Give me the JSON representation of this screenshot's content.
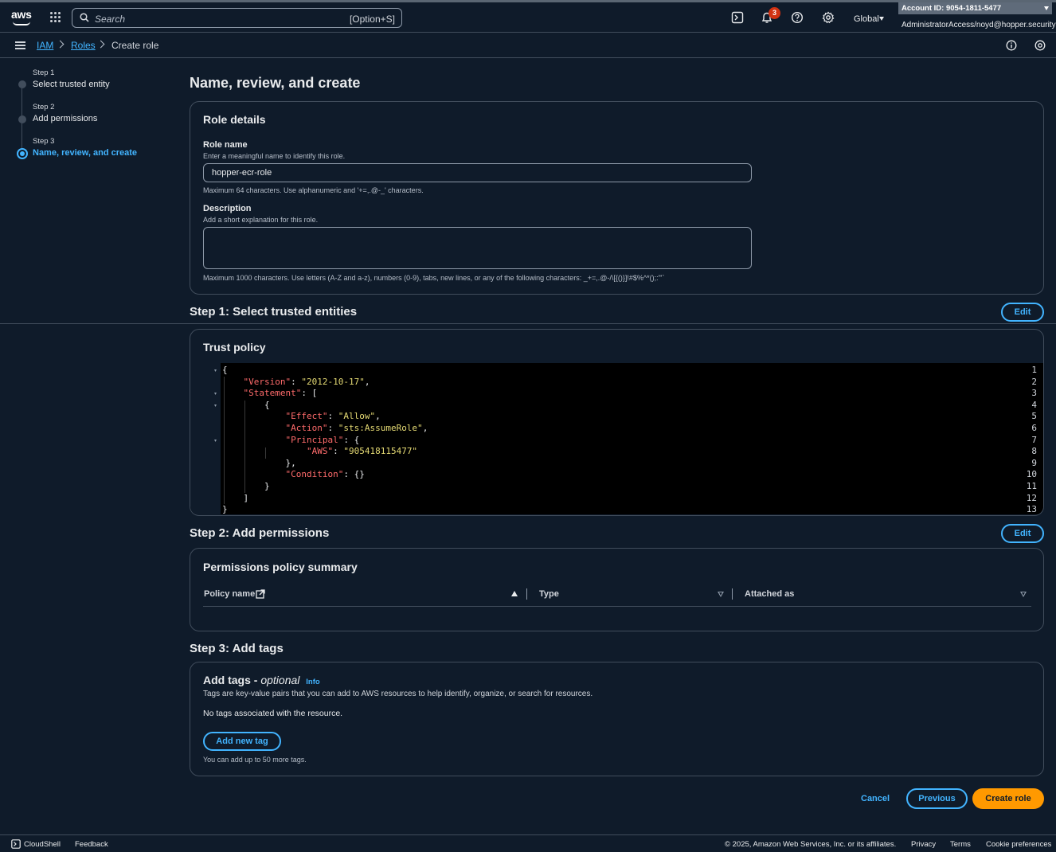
{
  "topnav": {
    "logo_text": "aws",
    "search_placeholder": "Search",
    "search_shortcut": "[Option+S]",
    "notification_count": "3",
    "region": "Global",
    "account_id": "Account ID: 9054-1811-5477",
    "account_user": "AdministratorAccess/noyd@hopper.security"
  },
  "breadcrumb": {
    "items": [
      "IAM",
      "Roles",
      "Create role"
    ]
  },
  "steps": [
    {
      "label": "Step 1",
      "title": "Select trusted entity"
    },
    {
      "label": "Step 2",
      "title": "Add permissions"
    },
    {
      "label": "Step 3",
      "title": "Name, review, and create"
    }
  ],
  "page_title": "Name, review, and create",
  "role_details": {
    "title": "Role details",
    "role_name_label": "Role name",
    "role_name_hint": "Enter a meaningful name to identify this role.",
    "role_name_value": "hopper-ecr-role",
    "role_name_constraint": "Maximum 64 characters. Use alphanumeric and '+=,.@-_' characters.",
    "description_label": "Description",
    "description_hint": "Add a short explanation for this role.",
    "description_value": "",
    "description_constraint": "Maximum 1000 characters. Use letters (A-Z and a-z), numbers (0-9), tabs, new lines, or any of the following characters: _+=,.@-/\\[{()}]!#$%^*();:\"'`"
  },
  "step1": {
    "heading": "Step 1: Select trusted entities",
    "edit_label": "Edit",
    "card_title": "Trust policy",
    "code_lines": [
      {
        "n": "1",
        "html": "{"
      },
      {
        "n": "2",
        "indent": 1,
        "key": "\"Version\"",
        "val": "\"2012-10-17\"",
        "tail": ","
      },
      {
        "n": "3",
        "indent": 1,
        "key": "\"Statement\"",
        "tail": ": ["
      },
      {
        "n": "4",
        "indent": 2,
        "plain": "{"
      },
      {
        "n": "5",
        "indent": 3,
        "key": "\"Effect\"",
        "val": "\"Allow\"",
        "tail": ","
      },
      {
        "n": "6",
        "indent": 3,
        "key": "\"Action\"",
        "val": "\"sts:AssumeRole\"",
        "tail": ","
      },
      {
        "n": "7",
        "indent": 3,
        "key": "\"Principal\"",
        "tail": ": {"
      },
      {
        "n": "8",
        "indent": 4,
        "key": "\"AWS\"",
        "val": "\"905418115477\"",
        "tail": ""
      },
      {
        "n": "9",
        "indent": 3,
        "plain": "},"
      },
      {
        "n": "10",
        "indent": 3,
        "key": "\"Condition\"",
        "tail": ": {}"
      },
      {
        "n": "11",
        "indent": 2,
        "plain": "}"
      },
      {
        "n": "12",
        "indent": 1,
        "plain": "]"
      },
      {
        "n": "13",
        "plain": "}"
      }
    ]
  },
  "step2": {
    "heading": "Step 2: Add permissions",
    "edit_label": "Edit",
    "card_title": "Permissions policy summary",
    "columns": [
      "Policy name",
      "Type",
      "Attached as"
    ]
  },
  "step3": {
    "heading": "Step 3: Add tags",
    "card_title_main": "Add tags - ",
    "card_title_optional": "optional",
    "info_link": "Info",
    "description": "Tags are key-value pairs that you can add to AWS resources to help identify, organize, or search for resources.",
    "empty_text": "No tags associated with the resource.",
    "add_tag_label": "Add new tag",
    "limit_text": "You can add up to 50 more tags."
  },
  "actions": {
    "cancel": "Cancel",
    "previous": "Previous",
    "create": "Create role"
  },
  "footer": {
    "cloudshell": "CloudShell",
    "feedback": "Feedback",
    "copyright": "© 2025, Amazon Web Services, Inc. or its affiliates.",
    "privacy": "Privacy",
    "terms": "Terms",
    "cookie": "Cookie preferences"
  },
  "colors": {
    "background": "#0f1b2a",
    "accent": "#42b4ff",
    "primary_button": "#ff9900",
    "border": "#414d5c",
    "json_key": "#ff6b6b",
    "json_string": "#e6db74"
  }
}
